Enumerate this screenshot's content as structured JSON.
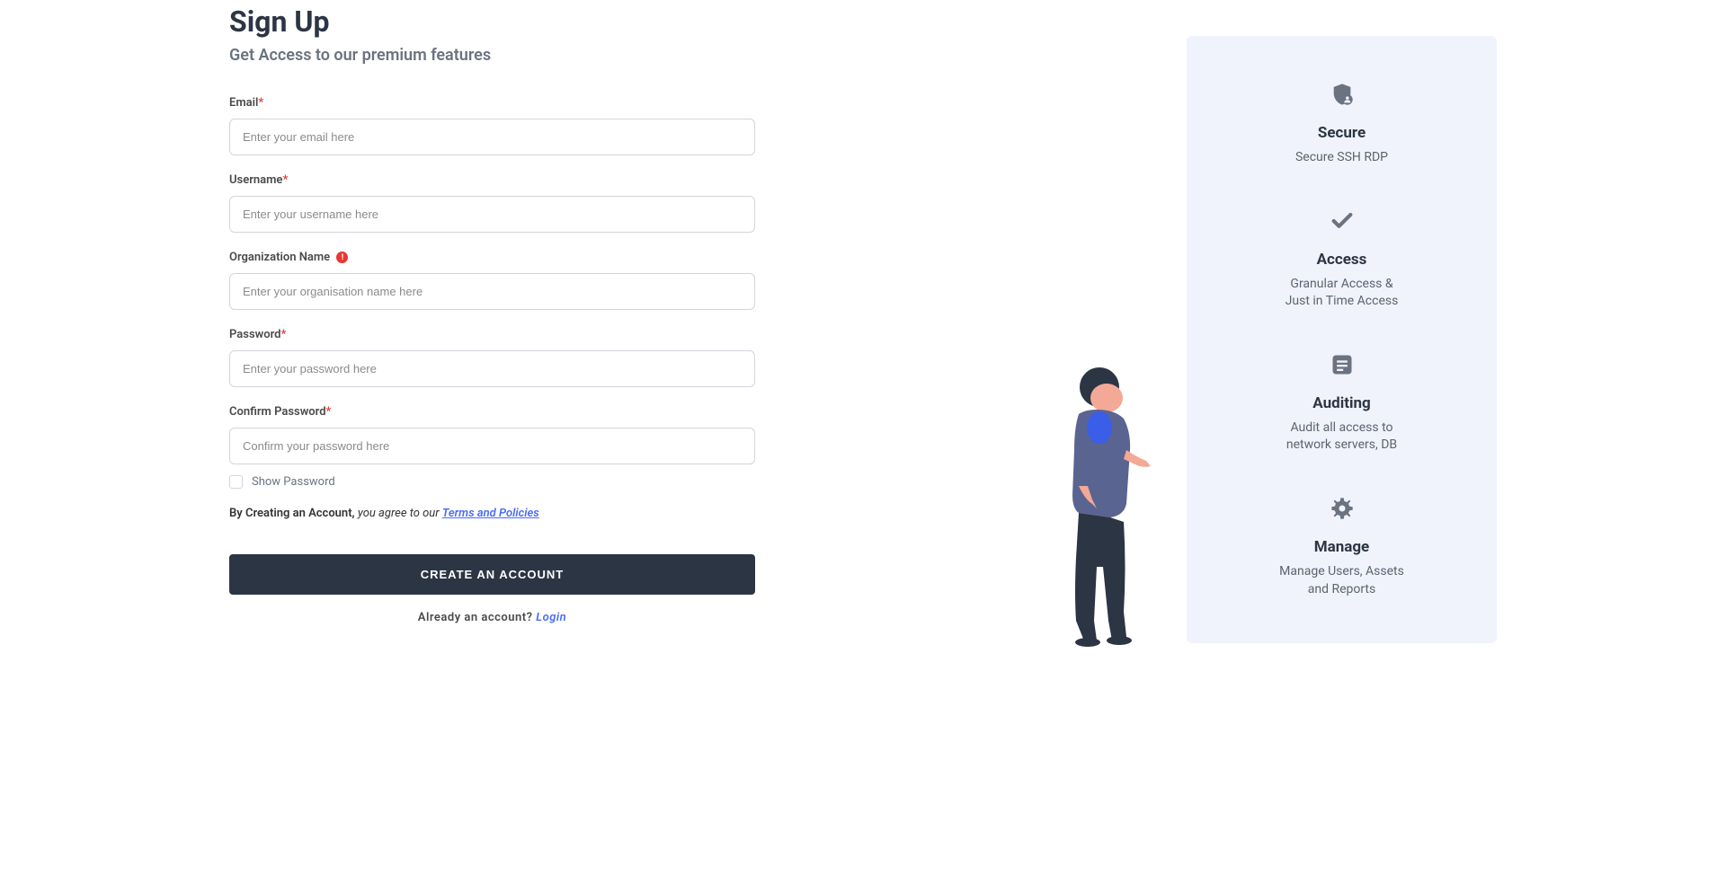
{
  "header": {
    "title": "Sign Up",
    "subtitle": "Get Access to our premium features"
  },
  "form": {
    "email": {
      "label": "Email",
      "placeholder": "Enter your email here"
    },
    "username": {
      "label": "Username",
      "placeholder": "Enter your username here"
    },
    "orgName": {
      "label": "Organization Name",
      "placeholder": "Enter your organisation name here"
    },
    "password": {
      "label": "Password",
      "placeholder": "Enter your password here"
    },
    "confirmPassword": {
      "label": "Confirm Password",
      "placeholder": "Confirm your password here"
    },
    "showPassword": "Show Password",
    "termsPrefix": "By Creating an Account, ",
    "termsItalic": "you agree to our ",
    "termsLink": "Terms and Policies",
    "submitButton": "CREATE AN ACCOUNT",
    "loginPrompt": "Already an account? ",
    "loginLink": "Login"
  },
  "features": [
    {
      "icon": "shield-user-icon",
      "title": "Secure",
      "desc": "Secure SSH RDP"
    },
    {
      "icon": "checkmark-icon",
      "title": "Access",
      "desc": "Granular Access &\nJust in Time Access"
    },
    {
      "icon": "document-icon",
      "title": "Auditing",
      "desc": "Audit all access to\nnetwork servers, DB"
    },
    {
      "icon": "gear-icon",
      "title": "Manage",
      "desc": "Manage Users, Assets\nand Reports"
    }
  ],
  "asterisk": "*",
  "infoBadge": "!"
}
